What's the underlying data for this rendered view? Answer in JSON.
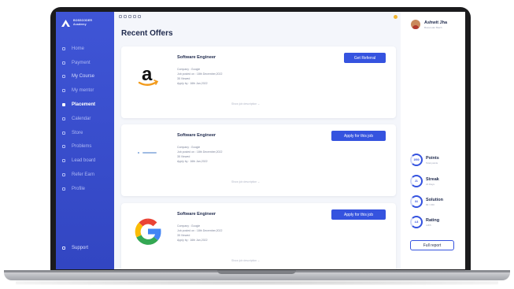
{
  "brand": {
    "line1": "BOSSCODER",
    "line2": "Academy"
  },
  "sidebar": {
    "items": [
      {
        "label": "Home",
        "icon": "home-icon",
        "state": "normal"
      },
      {
        "label": "Payment",
        "icon": "payment-icon",
        "state": "normal"
      },
      {
        "label": "My Course",
        "icon": "course-icon",
        "state": "bright"
      },
      {
        "label": "My mentor",
        "icon": "mentor-icon",
        "state": "normal"
      },
      {
        "label": "Placement",
        "icon": "placement-icon",
        "state": "active"
      },
      {
        "label": "Calendar",
        "icon": "calendar-icon",
        "state": "normal"
      },
      {
        "label": "Store",
        "icon": "store-icon",
        "state": "normal"
      },
      {
        "label": "Problems",
        "icon": "problems-icon",
        "state": "normal"
      },
      {
        "label": "Lead board",
        "icon": "leaderboard-icon",
        "state": "normal"
      },
      {
        "label": "Refer Earn",
        "icon": "refer-icon",
        "state": "normal"
      },
      {
        "label": "Profile",
        "icon": "profile-icon",
        "state": "normal"
      }
    ],
    "support": "Support"
  },
  "page_title": "Recent Offers",
  "offers": [
    {
      "company_logo": "amazon",
      "logo_text": "a",
      "role": "Software Engineer",
      "company": "Company : Google",
      "posted": "Job posted on : 18th December,2022",
      "viewed": "35 Viewed",
      "apply_by": "Apply by : 16th Jan,2022",
      "button": "Get Referral",
      "more": "Show job description"
    },
    {
      "company_logo": "generic",
      "logo_text": "",
      "role": "Software Engineer",
      "company": "Company : Google",
      "posted": "Job posted on : 18th December,2022",
      "viewed": "35 Viewed",
      "apply_by": "Apply by : 16th Jan,2022",
      "button": "Apply for this job",
      "more": "Show job description"
    },
    {
      "company_logo": "google",
      "logo_text": "G",
      "role": "Software Engineer",
      "company": "Company : Google",
      "posted": "Job posted on : 18th December,2022",
      "viewed": "35 Viewed",
      "apply_by": "Apply by : 16th Jan,2022",
      "button": "Apply for this job",
      "more": "Show job description"
    }
  ],
  "profile": {
    "name": "Ashwit Jha",
    "subtitle": "Bosscoder Batch"
  },
  "stats": [
    {
      "value": "1900",
      "label": "Points",
      "sub": "Total points"
    },
    {
      "value": "21",
      "label": "Streak",
      "sub": "21 Days"
    },
    {
      "value": "84",
      "label": "Solution",
      "sub": "84 / 150"
    },
    {
      "value": "4.8",
      "label": "Rating",
      "sub": "4.8/5"
    }
  ],
  "full_report": "Full report",
  "colors": {
    "accent": "#3553df",
    "sidebar": "#3f55d6",
    "notification": "#f2b632"
  }
}
